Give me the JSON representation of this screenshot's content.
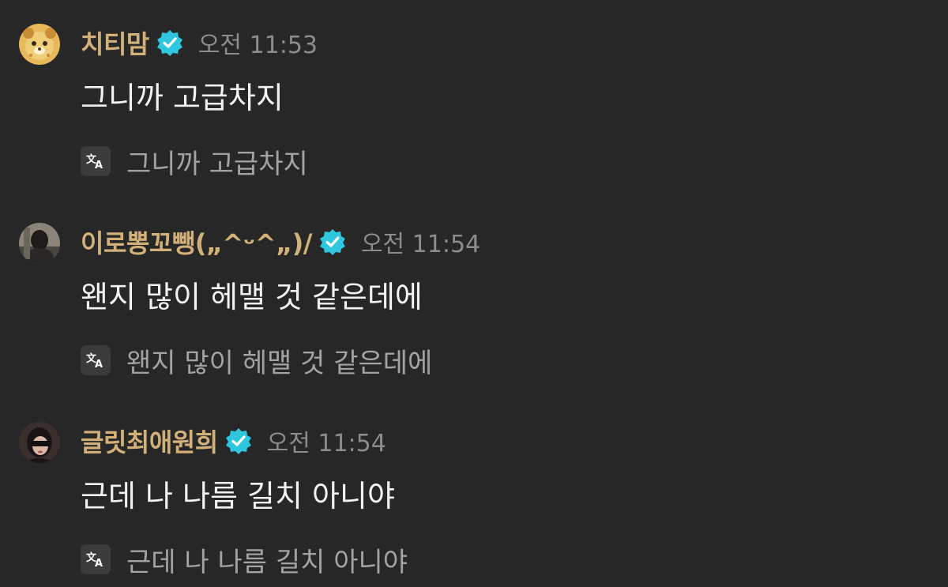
{
  "colors": {
    "background": "#272727",
    "username": "#d2b07a",
    "verified_badge": "#2fc6e0",
    "timestamp": "#8c8c8c",
    "message_text": "#f2f2f2",
    "translation_text": "#a3a3a3"
  },
  "messages": [
    {
      "username": "치티맘",
      "verified_icon": "verified-badge-icon",
      "time": "오전 11:53",
      "text": "그니까 고급차지",
      "translation_icon": "translate-icon",
      "translation": "그니까 고급차지"
    },
    {
      "username": "이로뽕꼬뺑(„^ᵕ^„)/",
      "verified_icon": "verified-badge-icon",
      "time": "오전 11:54",
      "text": "왠지 많이 헤맬 것 같은데에",
      "translation_icon": "translate-icon",
      "translation": "왠지 많이 헤맬 것 같은데에"
    },
    {
      "username": "글릿최애원희",
      "verified_icon": "verified-badge-icon",
      "time": "오전 11:54",
      "text": "근데 나 나름 길치 아니야",
      "translation_icon": "translate-icon",
      "translation": "근데 나 나름 길치 아니야"
    }
  ]
}
